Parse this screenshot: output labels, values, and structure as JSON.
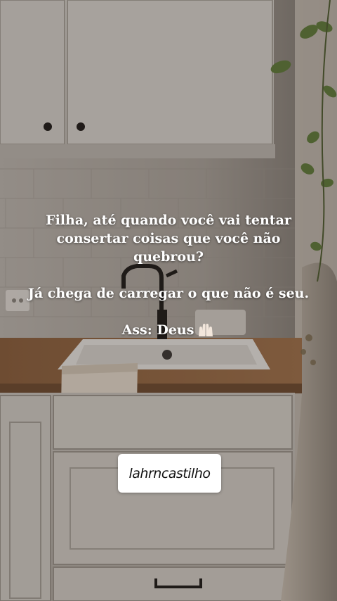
{
  "quote": {
    "line1": "Filha, até quando você vai tentar",
    "line2": "consertar coisas que você não",
    "line3": "quebrou?",
    "line4": "Já chega de carregar o que não é seu.",
    "signature": "Ass: Deus"
  },
  "watermark": {
    "handle": "lahrncastilho"
  },
  "icons": [
    "raising-hands-icon"
  ]
}
